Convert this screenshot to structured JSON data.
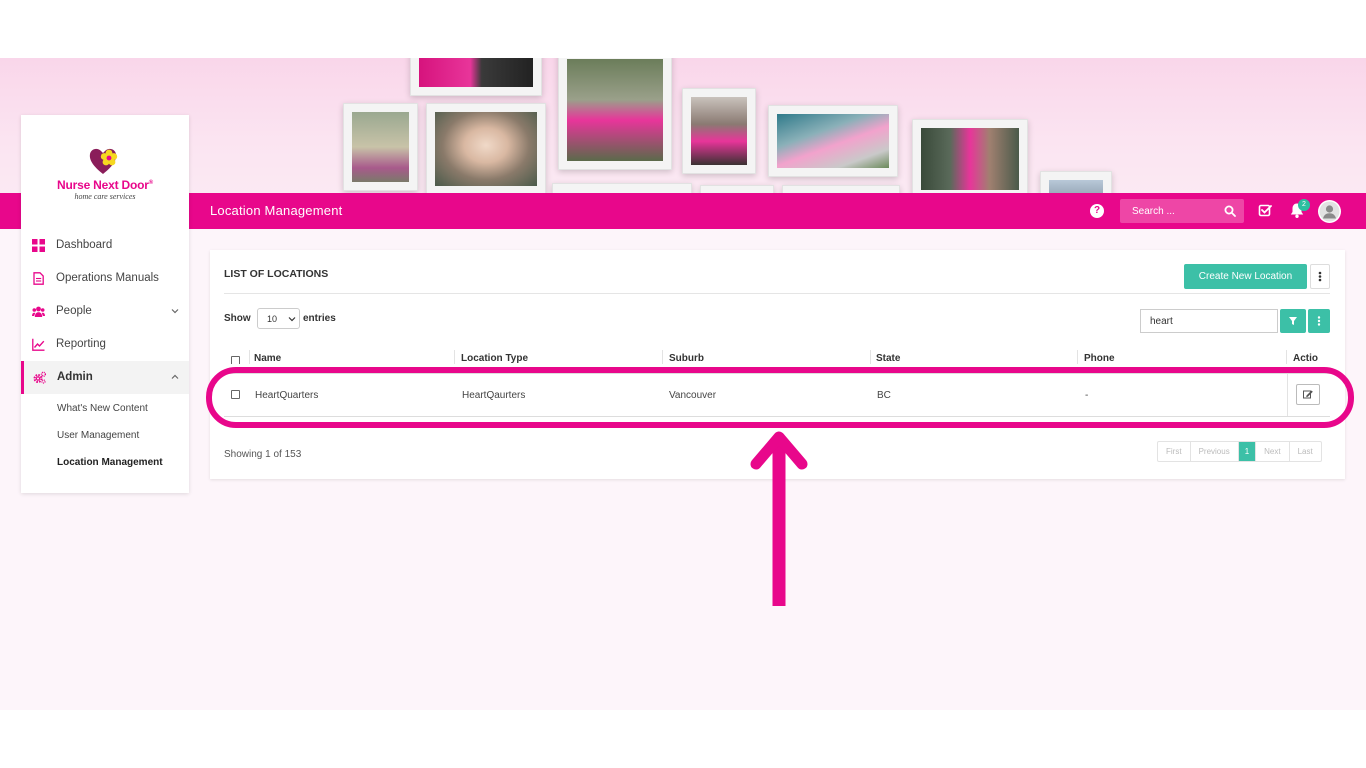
{
  "header": {
    "page_title": "Location Management",
    "search_placeholder": "Search ...",
    "notification_count": "2"
  },
  "brand": {
    "name": "Nurse Next Door",
    "trademark": "®",
    "tagline": "home care services",
    "accent_color": "#e8078b",
    "teal_color": "#3cc0a7"
  },
  "sidebar": {
    "items": [
      {
        "label": "Dashboard",
        "icon": "grid-icon"
      },
      {
        "label": "Operations Manuals",
        "icon": "document-icon"
      },
      {
        "label": "People",
        "icon": "users-icon"
      },
      {
        "label": "Reporting",
        "icon": "chart-line-icon"
      },
      {
        "label": "Admin",
        "icon": "cogs-icon"
      }
    ],
    "admin_subitems": [
      {
        "label": "What's New Content"
      },
      {
        "label": "User Management"
      },
      {
        "label": "Location Management"
      }
    ]
  },
  "list": {
    "title": "LIST OF LOCATIONS",
    "create_label": "Create New Location",
    "show_label": "Show",
    "page_length": "10",
    "entries_label": "entries",
    "filter_value": "heart",
    "columns": [
      "Name",
      "Location Type",
      "Suburb",
      "State",
      "Phone",
      "Actio"
    ],
    "rows": [
      {
        "name": "HeartQuarters",
        "location_type": "HeartQaurters",
        "suburb": "Vancouver",
        "state": "BC",
        "phone": "-"
      }
    ],
    "info": "Showing 1 of 153",
    "pagination": [
      "First",
      "Previous",
      "1",
      "Next",
      "Last"
    ]
  }
}
